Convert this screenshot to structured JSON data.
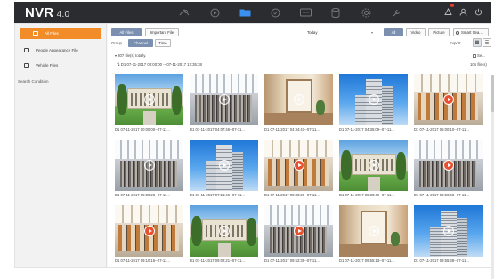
{
  "app": {
    "name": "NVR",
    "version": "4.0"
  },
  "nav_icons": [
    "live-view-icon",
    "playback-icon",
    "file-management-icon",
    "smart-analysis-icon",
    "alarm-icon",
    "storage-icon",
    "configuration-icon",
    "maintenance-icon"
  ],
  "sidebar": {
    "items": [
      {
        "label": "All Files",
        "active": true
      },
      {
        "label": "People Appearance File",
        "active": false
      },
      {
        "label": "Vehicle Files",
        "active": false
      }
    ],
    "search_condition": "Search Condition"
  },
  "toolbar": {
    "all_files": "All Files",
    "important_file": "Important File",
    "group_label": "Group",
    "channel": "Channel",
    "time": "Time",
    "date_filter": "Today",
    "type_all": "All",
    "type_video": "Video",
    "type_picture": "Picture",
    "smart_search": "Smart Sea...",
    "export": "Export"
  },
  "results": {
    "summary": "307 file(s) totally.",
    "range": "D1 07-11-2017 00:00:00 -- 07-11-2017 17:35:38",
    "count": "105 file(s)",
    "select_all": "Se..."
  },
  "thumbnails": [
    {
      "caption": "D1 07-11-2017 00:00:00--07-11...",
      "scene": "campus",
      "red": false
    },
    {
      "caption": "D1 07-11-2017 04:07:46--07-11...",
      "scene": "hall",
      "red": false
    },
    {
      "caption": "D1 07-11-2017 04:34:41--07-11...",
      "scene": "room",
      "red": false
    },
    {
      "caption": "D1 07-11-2017 04:35:09--07-11...",
      "scene": "tower",
      "red": false
    },
    {
      "caption": "D1 07-11-2017 05:00:10--07-11...",
      "scene": "office",
      "red": true
    },
    {
      "caption": "D1 07-11-2017 05:00:23--07-11...",
      "scene": "hall",
      "red": false
    },
    {
      "caption": "D1 07-11-2017 07:21:46--07-11...",
      "scene": "tower",
      "red": false
    },
    {
      "caption": "D1 07-11-2017 08:30:20--07-11...",
      "scene": "office",
      "red": true
    },
    {
      "caption": "D1 07-11-2017 08:30:46--07-11...",
      "scene": "campus",
      "red": false
    },
    {
      "caption": "D1 07-11-2017 08:59:43--07-11...",
      "scene": "hall",
      "red": true
    },
    {
      "caption": "D1 07-11-2017 09:10:16--07-11...",
      "scene": "office",
      "red": true
    },
    {
      "caption": "D1 07-11-2017 09:02:21--07-11...",
      "scene": "campus",
      "red": false
    },
    {
      "caption": "D1 07-11-2017 09:52:39--07-11...",
      "scene": "hall",
      "red": true
    },
    {
      "caption": "D1 07-11-2017 09:55:13--07-11...",
      "scene": "room",
      "red": false
    },
    {
      "caption": "D1 07-11-2017 09:55:38--07-11...",
      "scene": "tower",
      "red": false
    }
  ],
  "colors": {
    "accent": "#f28c28",
    "selected": "#7b8fb0",
    "topbar": "#2a2c30",
    "active_nav": "#3a8ff0"
  }
}
